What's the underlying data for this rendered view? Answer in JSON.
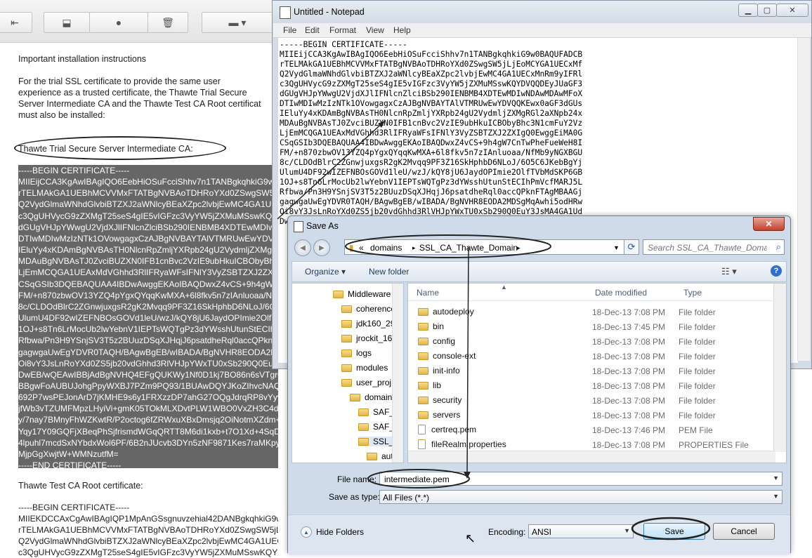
{
  "background_page": {
    "paragraph_1": "Important installation instructions",
    "paragraph_2": "For the trial SSL certificate to provide the same user\nexperience as a trusted certificate, the Thawte Trial Secure\nServer Intermediate CA and the Thawte Test CA Root certificat\nmust also be installed:",
    "intermediate_heading": "Thawte Trial Secure Server Intermediate CA:",
    "intermediate_cert_lines": [
      "-----BEGIN CERTIFICATE-----",
      "MIIEijCCA3KgAwIBAgIQO6EebHiOSuFcciShhv7n1TANBgkqhkiG9w0BAQUFADCB",
      "rTELMAkGA1UEBhMCVVMxFTATBgNVBAoTDHRoYXd0ZSwgSW5jLjEoMCYGA1UECxMf",
      "Q2VydGlmaWNhdGlvbiBTZXJ2aWNlcyBEaXZpc2lvbjEwMC4GA1UECxMnRm9yIFRl",
      "c3QgUHVycG9zZXMgT25seS4gIE5vIGFzc3VyYW5jZXMuMSswKQYDVQQDEyJUaGF3",
      "dGUgVHJpYWwgU2VjdXJlIFNlcnZlciBSb290IENBMB4XDTEwMDIwNDAwMDAwMFoX",
      "DTIwMDIwMzIzNTk1OVowgagxCzAJBgNVBAYTAlVTMRUwEwYDVQQKEwx0aGF3dGUs",
      "IEluYy4xKDAmBgNVBAsTH0NlcnRpZmljYXRpb24gU2VydmljZXMgRGl2aXNpb24x",
      "MDAuBgNVBAsTJ0ZvciBUZXN0IFB1cnBvc2VzIE9ubHkuICBObyBhc3N1cmFuY2Vz",
      "LjEmMCQGA1UEAxMdVGhhd3RlIFRyaWFsIFNlY3VyZSBTZXJ2ZXIgQ0EwggEiMA0G",
      "CSqGSIb3DQEBAQUAA4IBDwAwggEKAoIBAQDwxZ4vCS+9h4gW7CnTwPheFueWeH8I",
      "FM/+n870zbwOV13YZQ4pYgxQYqqKwMXA+6l8fkv5n7zIAnluoaa/NfMb9yNGXBGU",
      "8c/CLDOdBlrC2ZGnwjuxgsR2gK2Mvqq9PF3Z16SkHphbD6NLoJ/6O5C6JKebBgYj",
      "UlumU4DF92wIZEFNBOsGOVd1leU/wzJ/kQY8jU6JaydOPImie2OlfTVbMdSKP6GB",
      "1OJ+s8Tn6LrMocUb2lwYebnV1IEPTsWQTgPz3dYWsshUtunStECIhPmVcfMARJ5L",
      "Rfbwa/Pn3H9YSnjSV3T5z2BUuzDSqXJHqjJ6psatdheRql0accQPknFTAgMBAAGj",
      "gagwgaUwEgYDVR0TAQH/BAgwBgEB/wIBADA/BgNVHR8EODA2MDSgMqAwhi5odHRw",
      "Oi8vY3JsLnRoYXd0ZS5jb20vdGhhd3RlVHJpYWxTU0xSb290Q0EuY3JsMA4GA1Ud",
      "DwEB/wQEAwIBBjAdBgNVHQ4EFgQUKWy1Nf0D1kj7BO86n6sVTgr0TVAwHwYDVR0j",
      "BBgwFoAUBUJohgPpyWXBJ7PZm9PQ93/1BUAwDQYJKoZIhvcNAQEFBQADggEBAD5i",
      "692P7wsPEJonArD7jKMHE9s6y1FRXzzDP7ahG27OQgJdrqRP8vYyvvVgGwPKfZmy",
      "jfWb3vTZUMFMpzLHyiVi+gmK05TOkMLXDvtPLW1WBO0VxZH3C4d7pCxQz8GNUoTR",
      "y/7nay7BMnyFhWZKwtR/P2octog6fZRWxuXBxDmsjq2OiNotmXZdm+tGyjBkSeXh",
      "Yqy17Y09GQFjXBeqPhSjfrismdWGqQRTT8M6di1kxb+t7O1Xd+4SqDfq0uh0OkRu",
      "4lpuhl7mcdSxNYbdxWol6PF/6B2nJUcvb3DYn5zNF9871Kes7raMKpyRAq2I6x+R",
      "MjpGgXwjtW+WMNzutfM=",
      "-----END CERTIFICATE-----"
    ],
    "root_heading": "Thawte Test CA Root certificate:",
    "root_cert_lines": [
      "-----BEGIN CERTIFICATE-----",
      "MIIEKDCCAxCgAwIBAgIQP1MpAnGSsgnuvzehial42DANBgkqhkiG9w0BAQUFADCB",
      "rTELMAkGA1UEBhMCVVMxFTATBgNVBAoTDHRoYXd0ZSwgSW5jLjEoMCYGA1UECxMf",
      "Q2VydGlmaWNhdGlvbiBTZXJ2aWNlcyBEaXZpc2lvbjEwMC4GA1UECxMnRm9yIFRl",
      "c3QgUHVycG9zZXMgT25seS4gIE5vIGFzc3VyYW5jZXMuMSswKQYDVQQDEyJUaGF3"
    ]
  },
  "toolbar_icons": [
    "back-icon",
    "archive-icon",
    "report-spam-icon",
    "delete-icon",
    "folder-icon"
  ],
  "notepad": {
    "title": "Untitled - Notepad",
    "menu": [
      "File",
      "Edit",
      "Format",
      "View",
      "Help"
    ],
    "lines": [
      "-----BEGIN CERTIFICATE-----",
      "MIIEijCCA3KgAwIBAgIQO6EebHiOSuFcciShhv7n1TANBgkqhkiG9w0BAQUFADCB",
      "rTELMAkGA1UEBhMCVVMxFTATBgNVBAoTDHRoYXd0ZSwgSW5jLjEoMCYGA1UECxMf",
      "Q2VydGlmaWNhdGlvbiBTZXJ2aWNlcyBEaXZpc2lvbjEwMC4GA1UECxMnRm9yIFRl",
      "c3QgUHVycG9zZXMgT25seS4gIE5vIGFzc3VyYW5jZXMuMSswKQYDVQQDEyJUaGF3",
      "dGUgVHJpYWwgU2VjdXJlIFNlcnZlciBSb290IENBMB4XDTEwMDIwNDAwMDAwMFoX",
      "DTIwMDIwMzIzNTk1OVowgagxCzAJBgNVBAYTAlVTMRUwEwYDVQQKEwx0aGF3dGUs",
      "IEluYy4xKDAmBgNVBAsTH0NlcnRpZmljYXRpb24gU2VydmljZXMgRGl2aXNpb24x",
      "MDAuBgNVBAsTJ0ZvciBUZXN0IFB1cnBvc2VzIE9ubHkuICBObyBhc3N1cmFuY2Vz",
      "LjEmMCQGA1UEAxMdVGhhd3RlIFRyaWFsIFNlY3VyZSBTZXJ2ZXIgQ0EwggEiMA0G",
      "CSqGSIb3DQEBAQUAA4IBDwAwggEKAoIBAQDwxZ4vCS+9h4gW7CnTwPheFueWeH8I",
      "FM/+n870zbwOV13YZQ4pYgxQYqqKwMXA+6l8fkv5n7zIAnluoaa/NfMb9yNGXBGU",
      "8c/CLDOdBlrC2ZGnwjuxgsR2gK2Mvqq9PF3Z16SkHphbD6NLoJ/6O5C6JKebBgYj",
      "UlumU4DF92wIZEFNBOsGOVd1leU/wzJ/kQY8jU6JaydOPImie2OlfTVbMdSKP6GB",
      "1OJ+s8Tn6LrMocUb2lwYebnV1IEPTsWQTgPz3dYWsshUtunStECIhPmVcfMARJ5L",
      "Rfbwa/Pn3H9YSnjSV3T5z2BUuzDSqXJHqjJ6psatdheRql0accQPknFTAgMBAAGj",
      "gagwgaUwEgYDVR0TAQH/BAgwBgEB/wIBADA/BgNVHR8EODA2MDSgMqAwhi5odHRw",
      "Oi8vY3JsLnRoYXd0ZS5jb20vdGhhd3RlVHJpYWxTU0xSb290Q0EuY3JsMA4GA1Ud",
      "DwEB/wQEAwIBBjAdBgNVHQ4EFgQUKWy1Nf0D1kj7BO86n6sVTgr0TVAwHwYDVR0j"
    ]
  },
  "save_dialog": {
    "title": "Save As",
    "breadcrumb": {
      "prefix": "«",
      "items": [
        "domains",
        "SSL_CA_Thawte_Domain"
      ],
      "separator": "▸"
    },
    "search_placeholder": "Search SSL_CA_Thawte_Domain",
    "toolbar": {
      "organize": "Organize ▾",
      "new_folder": "New folder",
      "help": "?"
    },
    "tree": [
      "Middleware",
      "coherence",
      "jdk160_29",
      "jrockit_16",
      "logs",
      "modules",
      "user_proj",
      "domain",
      "SAF_D",
      "SAF_S",
      "SSL_C",
      "auto",
      "bin"
    ],
    "columns": [
      "Name",
      "Date modified",
      "Type",
      "Si"
    ],
    "files": [
      {
        "name": "autodeploy",
        "date": "18-Dec-13 7:08 PM",
        "type": "File folder",
        "kind": "folder"
      },
      {
        "name": "bin",
        "date": "18-Dec-13 7:45 PM",
        "type": "File folder",
        "kind": "folder"
      },
      {
        "name": "config",
        "date": "18-Dec-13 7:08 PM",
        "type": "File folder",
        "kind": "folder"
      },
      {
        "name": "console-ext",
        "date": "18-Dec-13 7:08 PM",
        "type": "File folder",
        "kind": "folder"
      },
      {
        "name": "init-info",
        "date": "18-Dec-13 7:08 PM",
        "type": "File folder",
        "kind": "folder"
      },
      {
        "name": "lib",
        "date": "18-Dec-13 7:08 PM",
        "type": "File folder",
        "kind": "folder"
      },
      {
        "name": "security",
        "date": "18-Dec-13 7:08 PM",
        "type": "File folder",
        "kind": "folder"
      },
      {
        "name": "servers",
        "date": "18-Dec-13 7:08 PM",
        "type": "File folder",
        "kind": "folder"
      },
      {
        "name": "certreq.pem",
        "date": "18-Dec-13 7:46 PM",
        "type": "PEM File",
        "kind": "file"
      },
      {
        "name": "fileRealm.properties",
        "date": "18-Dec-13 7:08 PM",
        "type": "PROPERTIES File",
        "kind": "lock-file"
      }
    ],
    "file_name_label": "File name:",
    "file_name_value": "intermediate.pem",
    "save_as_type_label": "Save as type:",
    "save_as_type_value": "All Files  (*.*)",
    "hide_folders": "Hide Folders",
    "encoding_label": "Encoding:",
    "encoding_value": "ANSI",
    "save_button": "Save",
    "cancel_button": "Cancel"
  }
}
